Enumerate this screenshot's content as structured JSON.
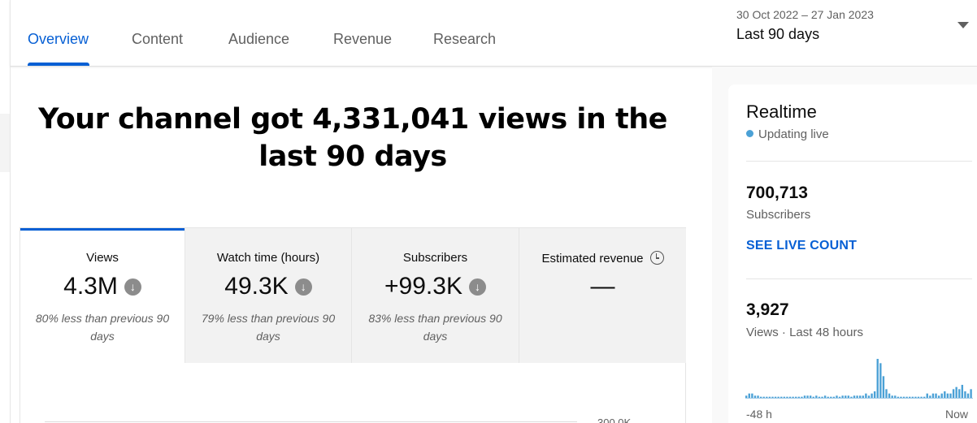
{
  "tabs": [
    {
      "label": "Overview",
      "active": true
    },
    {
      "label": "Content"
    },
    {
      "label": "Audience"
    },
    {
      "label": "Revenue"
    },
    {
      "label": "Research"
    }
  ],
  "date_range": {
    "dates": "30 Oct 2022 – 27 Jan 2023",
    "label": "Last 90 days"
  },
  "headline": "Your channel got 4,331,041 views in the last 90 days",
  "metrics": [
    {
      "label": "Views",
      "value": "4.3M",
      "note": "80% less than previous 90 days"
    },
    {
      "label": "Watch time (hours)",
      "value": "49.3K",
      "note": "79% less than previous 90 days"
    },
    {
      "label": "Subscribers",
      "value": "+99.3K",
      "note": "83% less than previous 90 days"
    },
    {
      "label": "Estimated revenue",
      "value": "—",
      "note": ""
    }
  ],
  "chart": {
    "y_tick": "300.0K"
  },
  "realtime": {
    "title": "Realtime",
    "status": "Updating live",
    "subscribers_value": "700,713",
    "subscribers_label": "Subscribers",
    "live_count_link": "SEE LIVE COUNT",
    "views_value": "3,927",
    "views_label": "Views · Last 48 hours",
    "axis_start": "-48 h",
    "axis_end": "Now"
  },
  "colors": {
    "accent": "#065fd4",
    "live_dot": "#4ba1d6",
    "spark_bar": "#4ba1d6"
  },
  "chart_data": {
    "type": "bar",
    "x_start": "-48 h",
    "x_end": "Now",
    "values": [
      1,
      2,
      2,
      1,
      1,
      0.5,
      0.5,
      0.5,
      0.5,
      0.5,
      0.5,
      0.5,
      0.5,
      0.5,
      0.5,
      0.5,
      0.5,
      0.5,
      0.5,
      0.5,
      1,
      1,
      1,
      0.5,
      1,
      0.5,
      0.5,
      1,
      0.5,
      0.5,
      0.5,
      1,
      0.5,
      1,
      1,
      1,
      0.5,
      1,
      1,
      1,
      1,
      2,
      1,
      2,
      3,
      18,
      16,
      10,
      4,
      2,
      1,
      1,
      0.5,
      0.5,
      0.5,
      0.5,
      0.5,
      0.5,
      0.5,
      0.5,
      0.5,
      0.5,
      2,
      1,
      2,
      2,
      1,
      2,
      3,
      2,
      2,
      4,
      5,
      4,
      6,
      3,
      2,
      4
    ]
  }
}
